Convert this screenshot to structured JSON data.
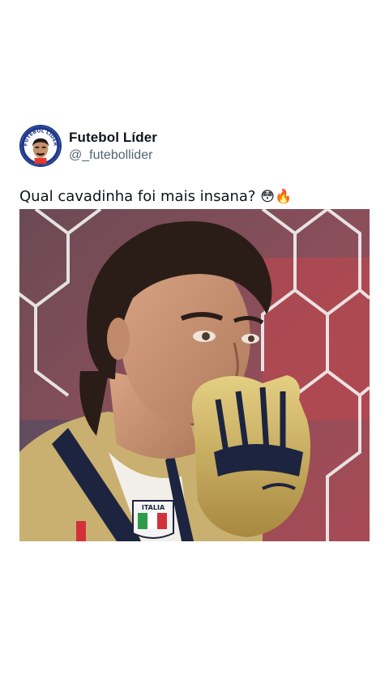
{
  "post": {
    "author": {
      "display_name": "Futebol Líder",
      "handle": "@_futebollider",
      "avatar_icon": "cartoon-person-avatar-icon",
      "avatar_ring_text": "FUTEBOL LÍDER"
    },
    "caption": {
      "text": "Qual cavadinha foi mais insana?",
      "emojis": "😳🔥"
    },
    "media": {
      "type": "photo",
      "description_icon": "goalkeeper-photo",
      "jersey_badge_text": "ITALIA"
    }
  },
  "colors": {
    "background": "#ffffff",
    "text": "#0f1419",
    "secondary_text": "#536471",
    "avatar_ring": "#1f3a8a"
  }
}
